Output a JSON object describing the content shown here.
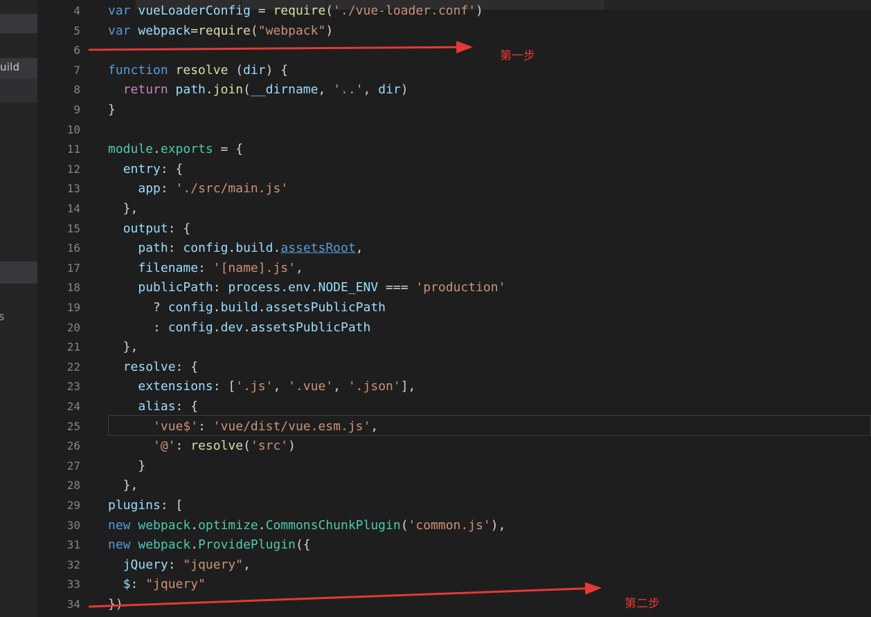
{
  "sidebar": {
    "partial_label": "uild",
    "partial_glyph": "s"
  },
  "editor": {
    "lines": [
      {
        "n": "4",
        "tokens": [
          [
            "kw",
            "var "
          ],
          [
            "prop",
            "vueLoaderConfig"
          ],
          [
            "op",
            " = "
          ],
          [
            "fn",
            "require"
          ],
          [
            "op",
            "("
          ],
          [
            "str",
            "'./vue-loader.conf'"
          ],
          [
            "op",
            ")"
          ]
        ]
      },
      {
        "n": "5",
        "tokens": [
          [
            "kw",
            "var "
          ],
          [
            "prop",
            "webpack"
          ],
          [
            "op",
            "="
          ],
          [
            "fn",
            "require"
          ],
          [
            "op",
            "("
          ],
          [
            "str",
            "\"webpack\""
          ],
          [
            "op",
            ")"
          ]
        ]
      },
      {
        "n": "6",
        "tokens": []
      },
      {
        "n": "7",
        "tokens": [
          [
            "kw",
            "function "
          ],
          [
            "fn",
            "resolve"
          ],
          [
            "op",
            " ("
          ],
          [
            "prop",
            "dir"
          ],
          [
            "op",
            ") {"
          ]
        ]
      },
      {
        "n": "8",
        "tokens": [
          [
            "op",
            "  "
          ],
          [
            "ctl",
            "return "
          ],
          [
            "prop",
            "path"
          ],
          [
            "op",
            "."
          ],
          [
            "fn",
            "join"
          ],
          [
            "op",
            "("
          ],
          [
            "prop",
            "__dirname"
          ],
          [
            "op",
            ", "
          ],
          [
            "str",
            "'..'"
          ],
          [
            "op",
            ", "
          ],
          [
            "prop",
            "dir"
          ],
          [
            "op",
            ")"
          ]
        ]
      },
      {
        "n": "9",
        "tokens": [
          [
            "op",
            "}"
          ]
        ]
      },
      {
        "n": "10",
        "tokens": []
      },
      {
        "n": "11",
        "tokens": [
          [
            "cls",
            "module"
          ],
          [
            "op",
            "."
          ],
          [
            "cls",
            "exports"
          ],
          [
            "op",
            " = {"
          ]
        ]
      },
      {
        "n": "12",
        "tokens": [
          [
            "op",
            "  "
          ],
          [
            "prop",
            "entry"
          ],
          [
            "op",
            ": {"
          ]
        ]
      },
      {
        "n": "13",
        "tokens": [
          [
            "op",
            "    "
          ],
          [
            "prop",
            "app"
          ],
          [
            "op",
            ": "
          ],
          [
            "str",
            "'./src/main.js'"
          ]
        ]
      },
      {
        "n": "14",
        "tokens": [
          [
            "op",
            "  },"
          ]
        ]
      },
      {
        "n": "15",
        "tokens": [
          [
            "op",
            "  "
          ],
          [
            "prop",
            "output"
          ],
          [
            "op",
            ": {"
          ]
        ]
      },
      {
        "n": "16",
        "tokens": [
          [
            "op",
            "    "
          ],
          [
            "prop",
            "path"
          ],
          [
            "op",
            ": "
          ],
          [
            "prop",
            "config"
          ],
          [
            "op",
            "."
          ],
          [
            "prop",
            "build"
          ],
          [
            "op",
            "."
          ],
          [
            "link",
            "assetsRoot"
          ],
          [
            "op",
            ","
          ]
        ]
      },
      {
        "n": "17",
        "tokens": [
          [
            "op",
            "    "
          ],
          [
            "prop",
            "filename"
          ],
          [
            "op",
            ": "
          ],
          [
            "str",
            "'[name].js'"
          ],
          [
            "op",
            ","
          ]
        ]
      },
      {
        "n": "18",
        "tokens": [
          [
            "op",
            "    "
          ],
          [
            "prop",
            "publicPath"
          ],
          [
            "op",
            ": "
          ],
          [
            "prop",
            "process"
          ],
          [
            "op",
            "."
          ],
          [
            "prop",
            "env"
          ],
          [
            "op",
            "."
          ],
          [
            "prop",
            "NODE_ENV"
          ],
          [
            "op",
            " === "
          ],
          [
            "str",
            "'production'"
          ]
        ]
      },
      {
        "n": "19",
        "tokens": [
          [
            "op",
            "      ? "
          ],
          [
            "prop",
            "config"
          ],
          [
            "op",
            "."
          ],
          [
            "prop",
            "build"
          ],
          [
            "op",
            "."
          ],
          [
            "prop",
            "assetsPublicPath"
          ]
        ]
      },
      {
        "n": "20",
        "tokens": [
          [
            "op",
            "      : "
          ],
          [
            "prop",
            "config"
          ],
          [
            "op",
            "."
          ],
          [
            "prop",
            "dev"
          ],
          [
            "op",
            "."
          ],
          [
            "prop",
            "assetsPublicPath"
          ]
        ]
      },
      {
        "n": "21",
        "tokens": [
          [
            "op",
            "  },"
          ]
        ]
      },
      {
        "n": "22",
        "tokens": [
          [
            "op",
            "  "
          ],
          [
            "prop",
            "resolve"
          ],
          [
            "op",
            ": {"
          ]
        ]
      },
      {
        "n": "23",
        "tokens": [
          [
            "op",
            "    "
          ],
          [
            "prop",
            "extensions"
          ],
          [
            "op",
            ": ["
          ],
          [
            "str",
            "'.js'"
          ],
          [
            "op",
            ", "
          ],
          [
            "str",
            "'.vue'"
          ],
          [
            "op",
            ", "
          ],
          [
            "str",
            "'.json'"
          ],
          [
            "op",
            "],"
          ]
        ]
      },
      {
        "n": "24",
        "tokens": [
          [
            "op",
            "    "
          ],
          [
            "prop",
            "alias"
          ],
          [
            "op",
            ": {"
          ]
        ]
      },
      {
        "n": "25",
        "tokens": [
          [
            "op",
            "      "
          ],
          [
            "str",
            "'vue$'"
          ],
          [
            "op",
            ": "
          ],
          [
            "str",
            "'vue/dist/vue.esm.js'"
          ],
          [
            "op",
            ","
          ]
        ]
      },
      {
        "n": "26",
        "tokens": [
          [
            "op",
            "      "
          ],
          [
            "str",
            "'@'"
          ],
          [
            "op",
            ": "
          ],
          [
            "fn",
            "resolve"
          ],
          [
            "op",
            "("
          ],
          [
            "str",
            "'src'"
          ],
          [
            "op",
            ")"
          ]
        ]
      },
      {
        "n": "27",
        "tokens": [
          [
            "op",
            "    }"
          ]
        ]
      },
      {
        "n": "28",
        "tokens": [
          [
            "op",
            "  },"
          ]
        ]
      },
      {
        "n": "29",
        "tokens": [
          [
            "prop",
            "plugins"
          ],
          [
            "op",
            ": ["
          ]
        ]
      },
      {
        "n": "30",
        "tokens": [
          [
            "kw",
            "new "
          ],
          [
            "cls",
            "webpack"
          ],
          [
            "op",
            "."
          ],
          [
            "cls",
            "optimize"
          ],
          [
            "op",
            "."
          ],
          [
            "cls",
            "CommonsChunkPlugin"
          ],
          [
            "op",
            "("
          ],
          [
            "str",
            "'common.js'"
          ],
          [
            "op",
            "),"
          ]
        ]
      },
      {
        "n": "31",
        "tokens": [
          [
            "kw",
            "new "
          ],
          [
            "cls",
            "webpack"
          ],
          [
            "op",
            "."
          ],
          [
            "cls",
            "ProvidePlugin"
          ],
          [
            "op",
            "({"
          ]
        ]
      },
      {
        "n": "32",
        "tokens": [
          [
            "op",
            "  "
          ],
          [
            "prop",
            "jQuery"
          ],
          [
            "op",
            ": "
          ],
          [
            "str",
            "\"jquery\""
          ],
          [
            "op",
            ","
          ]
        ]
      },
      {
        "n": "33",
        "tokens": [
          [
            "op",
            "  "
          ],
          [
            "prop",
            "$"
          ],
          [
            "op",
            ": "
          ],
          [
            "str",
            "\"jquery\""
          ]
        ]
      },
      {
        "n": "34",
        "tokens": [
          [
            "op",
            "})"
          ]
        ]
      }
    ]
  },
  "annotations": {
    "step1_label": "第一步",
    "step2_label": "第二步",
    "color": "#e53935"
  },
  "colors": {
    "editor_bg": "#1e1e1e",
    "sidebar_bg": "#252526",
    "keyword": "#569cd6",
    "control": "#c586c0",
    "function": "#dcdcaa",
    "string": "#ce9178",
    "property": "#9cdcfe",
    "class": "#4ec9b0"
  }
}
